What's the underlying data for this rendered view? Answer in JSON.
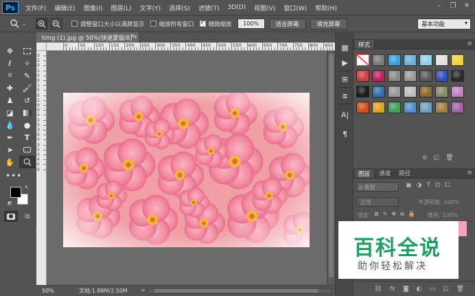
{
  "app": {
    "logo": "Ps",
    "menu": [
      "文件(F)",
      "编辑(E)",
      "图像(I)",
      "图层(L)",
      "文字(Y)",
      "选择(S)",
      "滤镜(T)",
      "3D(D)",
      "视图(V)",
      "窗口(W)",
      "帮助(H)"
    ],
    "window_controls": [
      "–",
      "❐",
      "✕"
    ]
  },
  "options": {
    "tool_icon": "zoom-icon",
    "checkboxes": [
      {
        "label": "调整窗口大小以满屏显示",
        "checked": false
      },
      {
        "label": "缩放所有窗口",
        "checked": false
      },
      {
        "label": "细微缩放",
        "checked": true
      }
    ],
    "zoom_value": "100%",
    "fit_screen": "适合屏幕",
    "fill_screen": "填充屏幕",
    "workspace": "基本功能"
  },
  "document": {
    "tab_title": "timg (1).jpg @ 50%(快速蒙版/8) *",
    "tab_close": "×",
    "ruler_h_labels": [
      "0",
      "50",
      "100",
      "150",
      "200",
      "250",
      "300",
      "350",
      "400",
      "450",
      "500",
      "550",
      "600",
      "650",
      "700",
      "750",
      "800",
      "850",
      "900"
    ],
    "ruler_v_labels": [
      "0",
      "5",
      "0",
      "1",
      "0",
      "0",
      "1",
      "5",
      "0",
      "2",
      "0",
      "0",
      "2",
      "5",
      "0",
      "3",
      "0",
      "0",
      "3",
      "5",
      "0",
      "4",
      "0",
      "0"
    ]
  },
  "status": {
    "zoom": "50%",
    "doc_info": "文档:1.88M/2.50M",
    "arrow": ">"
  },
  "panels": {
    "styles_tab": "样式",
    "styles_swatches": [
      "none",
      "#7a7a7a",
      "#3aa0d8",
      "#6ab0e0",
      "#8fd0f0",
      "#e0e0e0",
      "#f0d040",
      "#d04040",
      "#c02060",
      "#8a8a8a",
      "#9a9a9a",
      "#5a5a5a",
      "#3050c0",
      "#2a2a2a",
      "#1a1a1a",
      "#3070b0",
      "#9a9a9a",
      "#bdbdbd",
      "#8a6a30",
      "#8a8a6a",
      "#c080c0",
      "#d05020",
      "#e0a020",
      "#40a060",
      "#5090d0",
      "#70a0c0",
      "#a08040",
      "#a060a0"
    ],
    "layers_tabs": [
      "图层",
      "通道",
      "路径"
    ],
    "filter_label": "ρ 类型",
    "blend_mode": "正常",
    "opacity_label": "不透明度: 100%",
    "lock_label": "锁定:",
    "fill_label": "填充: 100%"
  },
  "watermark": {
    "main": "百科全说",
    "sub": "助你轻松解决"
  }
}
